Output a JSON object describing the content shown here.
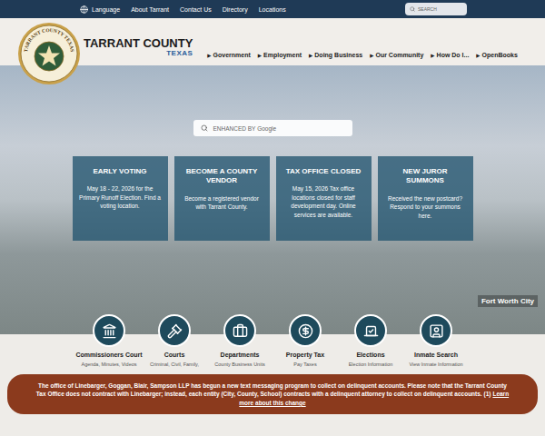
{
  "topbar": {
    "links": [
      "Language",
      "About Tarrant",
      "Contact Us",
      "Directory",
      "Locations"
    ],
    "search": {
      "placeholder": "SEARCH"
    }
  },
  "logo": {
    "seal": "TARRANT COUNTY TEXAS",
    "name": "TARRANT COUNTY",
    "state": "TEXAS"
  },
  "nav": {
    "marker": "▶",
    "items": [
      "Government",
      "Employment",
      "Doing Business",
      "Our Community",
      "How Do I...",
      "OpenBooks"
    ]
  },
  "hero": {
    "search": {
      "placeholder": "ENHANCED BY Google"
    },
    "caption": "Fort Worth City",
    "cards": [
      {
        "title": "EARLY VOTING",
        "text": "May 18 - 22, 2026 for the Primary Runoff Election. Find a voting location."
      },
      {
        "title": "BECOME A COUNTY VENDOR",
        "text": "Become a registered vendor with Tarrant County."
      },
      {
        "title": "TAX OFFICE CLOSED",
        "text": "May 15, 2026 Tax office locations closed for staff development day. Online services are available."
      },
      {
        "title": "NEW JUROR SUMMONS",
        "text": "Received the new postcard? Respond to your summons here."
      }
    ]
  },
  "quick_links": [
    {
      "title": "Commissioners Court",
      "subtitle": "Agenda, Minutes, Videos"
    },
    {
      "title": "Courts",
      "subtitle": "Criminal, Civil, Family,"
    },
    {
      "title": "Departments",
      "subtitle": "County Business Units"
    },
    {
      "title": "Property Tax",
      "subtitle": "Pay Taxes"
    },
    {
      "title": "Elections",
      "subtitle": "Election Information"
    },
    {
      "title": "Inmate Search",
      "subtitle": "View Inmate Information"
    }
  ],
  "alert": {
    "text": "The office of Linebarger, Goggan, Blair, Sampson LLP has begun a new text messaging program to collect on delinquent accounts. Please note that the Tarrant County Tax Office does not contract with Linebarger; instead, each entity (City, County, School) contracts with a delinquent attorney to collect on delinquent accounts. (1)",
    "link": "Learn more about this change"
  }
}
